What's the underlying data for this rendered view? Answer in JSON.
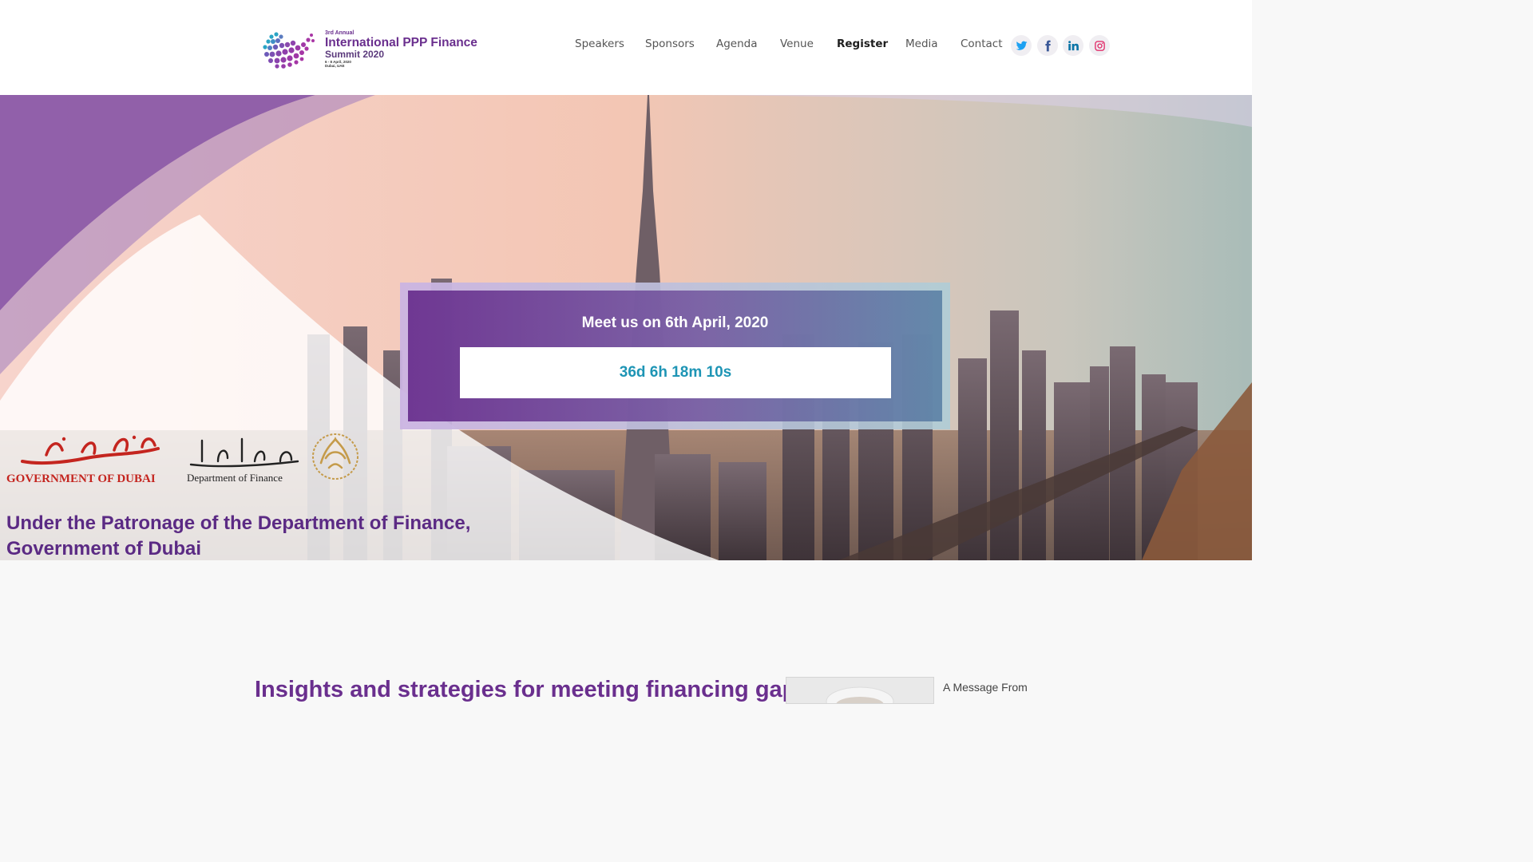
{
  "logo": {
    "kicker": "3rd Annual",
    "title": "International PPP Finance",
    "subtitle": "Summit 2020",
    "dates": "6 - 8 April, 2020",
    "location": "Dubai, UAE"
  },
  "nav": {
    "items": [
      {
        "label": "Speakers"
      },
      {
        "label": "Sponsors"
      },
      {
        "label": "Agenda"
      },
      {
        "label": "Venue"
      },
      {
        "label": "Register"
      },
      {
        "label": "Media"
      },
      {
        "label": "Contact"
      }
    ]
  },
  "social": {
    "twitter_icon": "twitter-icon",
    "facebook_icon": "facebook-icon",
    "linkedin_icon": "linkedin-icon",
    "instagram_icon": "instagram-icon"
  },
  "hero": {
    "countdown_title": "Meet us on 6th April, 2020",
    "countdown_value": "36d 6h 18m 10s",
    "gov_logo_en": "GOVERNMENT OF DUBAI",
    "gov_logo_ar": "حكومة دبي",
    "dof_logo_en": "Department of Finance",
    "dof_logo_ar": "دائرة المالية",
    "patronage_line1": "Under the Patronage of the Department of Finance,",
    "patronage_line2": "Government of Dubai"
  },
  "content": {
    "insights_heading": "Insights and strategies for meeting financing gaps",
    "message_label": "A Message From"
  },
  "colors": {
    "brand_purple": "#6a2f8e",
    "countdown_text": "#1e95b5",
    "gov_red": "#c4251f"
  }
}
